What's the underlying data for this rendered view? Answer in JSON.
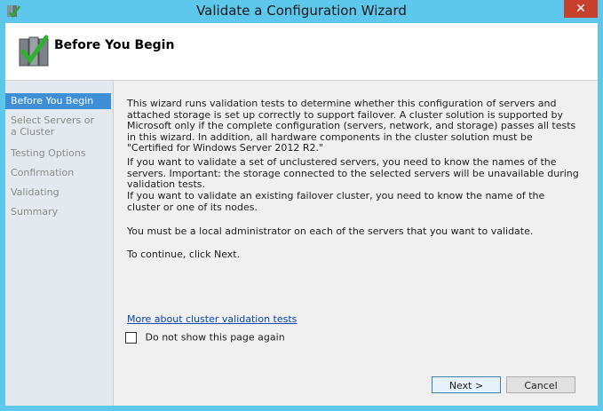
{
  "window": {
    "title": "Validate a Configuration Wizard",
    "close_label": "✕"
  },
  "header": {
    "title": "Before You Begin"
  },
  "nav": {
    "items": [
      {
        "label": "Before You Begin",
        "active": true
      },
      {
        "label": "Select Servers or a Cluster",
        "active": false
      },
      {
        "label": "Testing Options",
        "active": false
      },
      {
        "label": "Confirmation",
        "active": false
      },
      {
        "label": "Validating",
        "active": false
      },
      {
        "label": "Summary",
        "active": false
      }
    ]
  },
  "content": {
    "paragraphs": [
      "This wizard runs validation tests to determine whether this configuration of servers and attached storage is set up correctly to support failover. A cluster solution is supported by Microsoft only if the complete configuration (servers, network, and storage) passes all tests in this wizard. In addition, all hardware components in the cluster solution must be \"Certified for Windows Server 2012 R2.\"",
      "If you want to validate a set of unclustered servers, you need to know the names of the servers. Important: the storage connected to the selected servers will be unavailable during validation tests.",
      "If you want to validate an existing failover cluster, you need to know the name of the cluster or one of its nodes.",
      "You must be a local administrator on each of the servers that you want to validate.",
      "To continue, click Next."
    ],
    "more_link": "More about cluster validation tests",
    "checkbox_label": "Do not show this page again",
    "checkbox_checked": false
  },
  "buttons": {
    "next": "Next >",
    "cancel": "Cancel"
  },
  "colors": {
    "frame": "#5ec8ec",
    "nav_active": "#3f8fd8",
    "close": "#c7402e",
    "link": "#0645ad"
  }
}
